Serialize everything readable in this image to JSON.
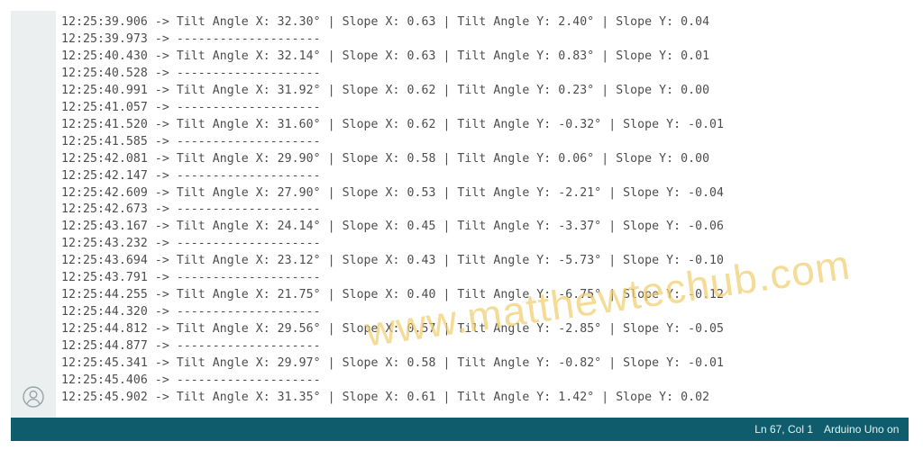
{
  "serial_monitor": {
    "lines": [
      "12:25:39.906 -> Tilt Angle X: 32.30° | Slope X: 0.63 | Tilt Angle Y: 2.40° | Slope Y: 0.04",
      "12:25:39.973 -> --------------------",
      "12:25:40.430 -> Tilt Angle X: 32.14° | Slope X: 0.63 | Tilt Angle Y: 0.83° | Slope Y: 0.01",
      "12:25:40.528 -> --------------------",
      "12:25:40.991 -> Tilt Angle X: 31.92° | Slope X: 0.62 | Tilt Angle Y: 0.23° | Slope Y: 0.00",
      "12:25:41.057 -> --------------------",
      "12:25:41.520 -> Tilt Angle X: 31.60° | Slope X: 0.62 | Tilt Angle Y: -0.32° | Slope Y: -0.01",
      "12:25:41.585 -> --------------------",
      "12:25:42.081 -> Tilt Angle X: 29.90° | Slope X: 0.58 | Tilt Angle Y: 0.06° | Slope Y: 0.00",
      "12:25:42.147 -> --------------------",
      "12:25:42.609 -> Tilt Angle X: 27.90° | Slope X: 0.53 | Tilt Angle Y: -2.21° | Slope Y: -0.04",
      "12:25:42.673 -> --------------------",
      "12:25:43.167 -> Tilt Angle X: 24.14° | Slope X: 0.45 | Tilt Angle Y: -3.37° | Slope Y: -0.06",
      "12:25:43.232 -> --------------------",
      "12:25:43.694 -> Tilt Angle X: 23.12° | Slope X: 0.43 | Tilt Angle Y: -5.73° | Slope Y: -0.10",
      "12:25:43.791 -> --------------------",
      "12:25:44.255 -> Tilt Angle X: 21.75° | Slope X: 0.40 | Tilt Angle Y: -6.75° | Slope Y: -0.12",
      "12:25:44.320 -> --------------------",
      "12:25:44.812 -> Tilt Angle X: 29.56° | Slope X: 0.57 | Tilt Angle Y: -2.85° | Slope Y: -0.05",
      "12:25:44.877 -> --------------------",
      "12:25:45.341 -> Tilt Angle X: 29.97° | Slope X: 0.58 | Tilt Angle Y: -0.82° | Slope Y: -0.01",
      "12:25:45.406 -> --------------------",
      "12:25:45.902 -> Tilt Angle X: 31.35° | Slope X: 0.61 | Tilt Angle Y: 1.42° | Slope Y: 0.02"
    ]
  },
  "gutter": {
    "icon": "user-avatar-icon"
  },
  "status_bar": {
    "cursor_position": "Ln 67, Col 1",
    "board": "Arduino Uno on"
  },
  "watermark": {
    "text": "www.matthewtechub.com"
  },
  "colors": {
    "status_bar_bg": "#0f5d6c",
    "gutter_bg": "#eceff0",
    "log_text": "#4d4d4d",
    "watermark": "#f0cd6e"
  }
}
